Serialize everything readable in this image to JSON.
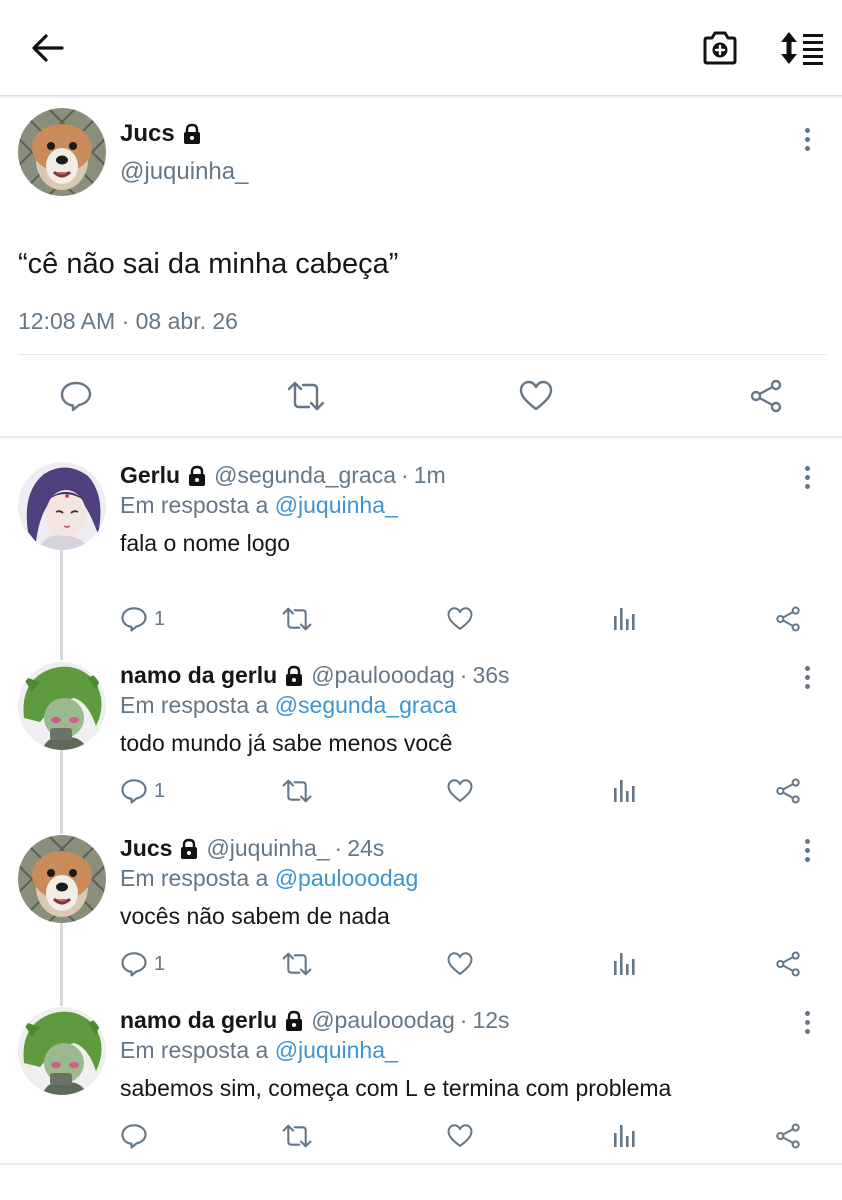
{
  "header": {
    "back_icon": "arrow-left-icon",
    "camera_icon": "camera-plus-icon",
    "sort_icon": "sort-list-icon"
  },
  "main_tweet": {
    "name": "Jucs",
    "handle": "@juquinha_",
    "text": "“cê não sai da minha cabeça”",
    "timestamp": "12:08 AM · 08 abr. 26",
    "protected": true
  },
  "replies": [
    {
      "name": "Gerlu",
      "handle": "@segunda_graca",
      "sep": "·",
      "time": "1m",
      "in_reply_prefix": "Em resposta a",
      "in_reply_to": "@juquinha_",
      "text": "fala o nome logo",
      "reply_count": "1",
      "protected": true
    },
    {
      "name": "namo da gerlu",
      "handle": "@paulooodag",
      "sep": "·",
      "time": "36s",
      "in_reply_prefix": "Em resposta a",
      "in_reply_to": "@segunda_graca",
      "text": "todo mundo já sabe menos você",
      "reply_count": "1",
      "protected": true
    },
    {
      "name": "Jucs",
      "handle": "@juquinha_",
      "sep": "·",
      "time": "24s",
      "in_reply_prefix": "Em resposta a",
      "in_reply_to": "@paulooodag",
      "text": "vocês não sabem de nada",
      "reply_count": "1",
      "protected": true
    },
    {
      "name": "namo da gerlu",
      "handle": "@paulooodag",
      "sep": "·",
      "time": "12s",
      "in_reply_prefix": "Em resposta a",
      "in_reply_to": "@juquinha_",
      "text": "sabemos sim, começa com L e termina com problema",
      "reply_count": "",
      "protected": true
    }
  ],
  "colors": {
    "text": "#14171a",
    "secondary": "#657786",
    "mention": "#3d94d1",
    "divider": "#e1e8ed"
  }
}
